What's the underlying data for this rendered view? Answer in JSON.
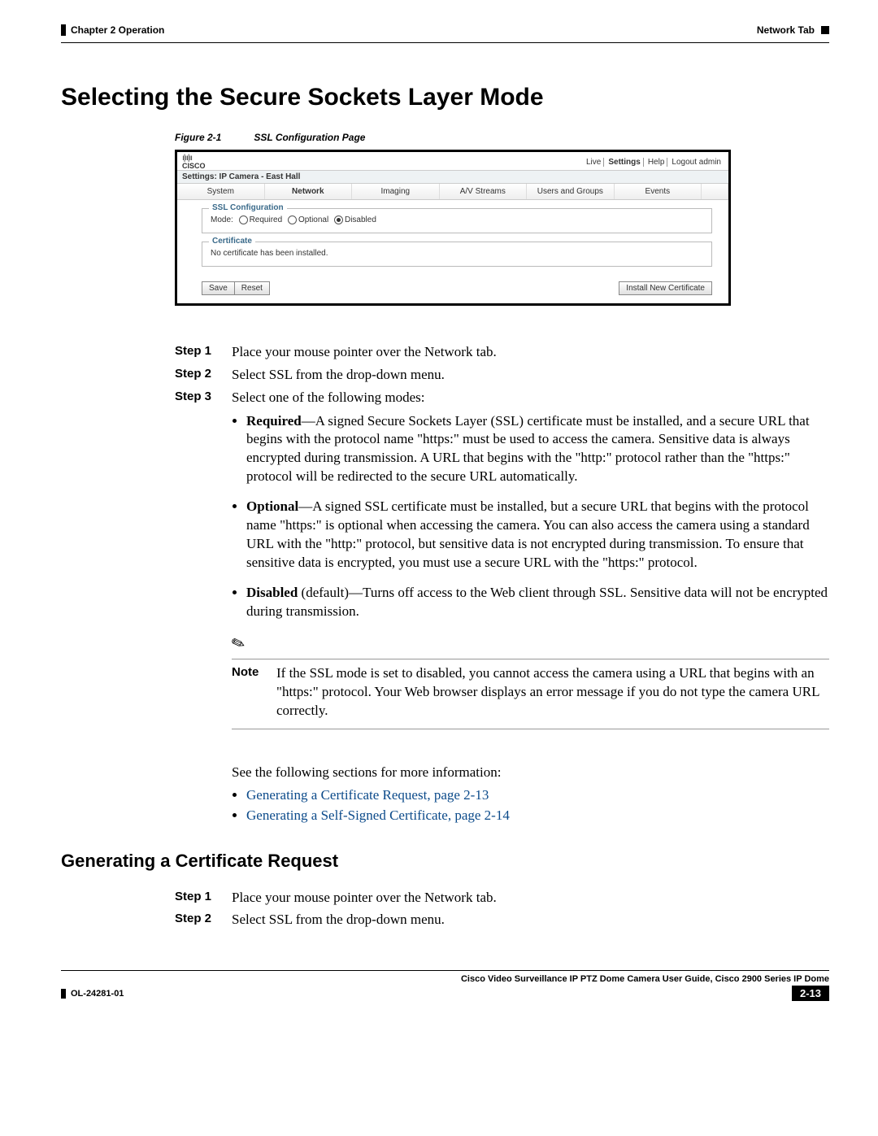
{
  "header": {
    "chapter": "Chapter 2      Operation",
    "tab": "Network Tab"
  },
  "title": "Selecting the Secure Sockets Layer Mode",
  "figure": {
    "label": "Figure 2-1",
    "caption": "SSL Configuration Page"
  },
  "screenshot": {
    "links": {
      "live": "Live",
      "settings": "Settings",
      "help": "Help",
      "logout": "Logout admin"
    },
    "settings_label": "Settings: IP Camera - East Hall",
    "tabs": {
      "system": "System",
      "network": "Network",
      "imaging": "Imaging",
      "av": "A/V Streams",
      "users": "Users and Groups",
      "events": "Events"
    },
    "ssl_legend": "SSL Configuration",
    "mode_label": "Mode:",
    "mode_required": "Required",
    "mode_optional": "Optional",
    "mode_disabled": "Disabled",
    "cert_legend": "Certificate",
    "cert_text": "No certificate has been installed.",
    "save": "Save",
    "reset": "Reset",
    "install": "Install New Certificate"
  },
  "steps1": {
    "s1_label": "Step 1",
    "s1_text": "Place your mouse pointer over the Network tab.",
    "s2_label": "Step 2",
    "s2_text": "Select SSL from the drop-down menu.",
    "s3_label": "Step 3",
    "s3_text": "Select one of the following modes:",
    "bullet_required_label": "Required",
    "bullet_required_text": "—A signed Secure Sockets Layer (SSL) certificate must be installed, and a secure URL that begins with the protocol name \"https:\" must be used to access the camera. Sensitive data is always encrypted during transmission. A URL that begins with the \"http:\" protocol rather than the \"https:\" protocol will be redirected to the secure URL automatically.",
    "bullet_optional_label": "Optional",
    "bullet_optional_text": "—A signed SSL certificate must be installed, but a secure URL that begins with the protocol name \"https:\" is optional when accessing the camera. You can also access the camera using a standard URL with the \"http:\" protocol, but sensitive data is not encrypted during transmission. To ensure that sensitive data is encrypted, you must use a secure URL with the \"https:\" protocol.",
    "bullet_disabled_label": "Disabled",
    "bullet_disabled_suffix": " (default)—Turns off access to the Web client through SSL. Sensitive data will not be encrypted during transmission.",
    "note_label": "Note",
    "note_text": "If the SSL mode is set to disabled, you cannot access the camera using a URL that begins with an \"https:\" protocol. Your Web browser displays an error message if you do not type the camera URL correctly."
  },
  "after": {
    "intro": "See the following sections for more information:",
    "link1": "Generating a Certificate Request, page 2-13",
    "link2": "Generating a Self-Signed Certificate, page 2-14"
  },
  "subsection": "Generating a Certificate Request",
  "steps2": {
    "s1_label": "Step 1",
    "s1_text": "Place your mouse pointer over the Network tab.",
    "s2_label": "Step 2",
    "s2_text": "Select SSL from the drop-down menu."
  },
  "footer": {
    "doc": "Cisco Video Surveillance IP PTZ Dome Camera User Guide, Cisco 2900 Series IP Dome",
    "ol": "OL-24281-01",
    "page": "2-13"
  }
}
